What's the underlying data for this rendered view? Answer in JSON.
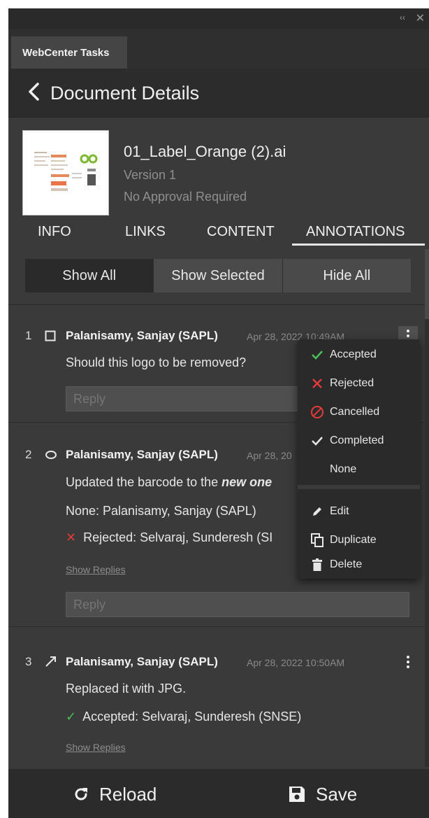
{
  "window": {
    "collapse_glyph": "‹‹",
    "close_glyph": "✕"
  },
  "panel_tab": "WebCenter Tasks",
  "header": {
    "title": "Document Details",
    "back_icon": "chevron-left-icon"
  },
  "document": {
    "name": "01_Label_Orange (2).ai",
    "version": "Version 1",
    "approval": "No Approval Required"
  },
  "tabs": [
    {
      "label": "INFO"
    },
    {
      "label": "LINKS"
    },
    {
      "label": "CONTENT"
    },
    {
      "label": "ANNOTATIONS",
      "active": true
    }
  ],
  "filter": {
    "show_all": "Show All",
    "show_selected": "Show Selected",
    "hide_all": "Hide All",
    "active": "Show All"
  },
  "annotations": [
    {
      "num": "1",
      "marker": "square-icon",
      "author": "Palanisamy, Sanjay (SAPL)",
      "date": "Apr 28, 2022 10:49AM",
      "text": "Should this logo to be removed?",
      "reply_placeholder": "Reply"
    },
    {
      "num": "2",
      "marker": "ellipse-icon",
      "author": "Palanisamy, Sanjay (SAPL)",
      "date": "Apr 28, 20",
      "text_before": "Updated the barcode to the ",
      "text_em": "new one",
      "status_none": "None: Palanisamy, Sanjay (SAPL)",
      "status_rejected": "Rejected: Selvaraj, Sunderesh (SI",
      "show_replies": "Show Replies",
      "reply_placeholder": "Reply"
    },
    {
      "num": "3",
      "marker": "arrow-icon",
      "author": "Palanisamy, Sanjay (SAPL)",
      "date": "Apr 28, 2022 10:50AM",
      "text": "Replaced it with JPG.",
      "status_accepted": "Accepted: Selvaraj, Sunderesh (SNSE)",
      "show_replies": "Show Replies"
    }
  ],
  "context_menu": {
    "accepted": "Accepted",
    "rejected": "Rejected",
    "cancelled": "Cancelled",
    "completed": "Completed",
    "none": "None",
    "edit": "Edit",
    "duplicate": "Duplicate",
    "delete": "Delete"
  },
  "footer": {
    "reload": "Reload",
    "save": "Save"
  },
  "colors": {
    "panel_bg": "#3a3a3a",
    "header_bg": "#2c2c2c",
    "accept_green": "#4bbf5a",
    "reject_red": "#e23b3b"
  }
}
